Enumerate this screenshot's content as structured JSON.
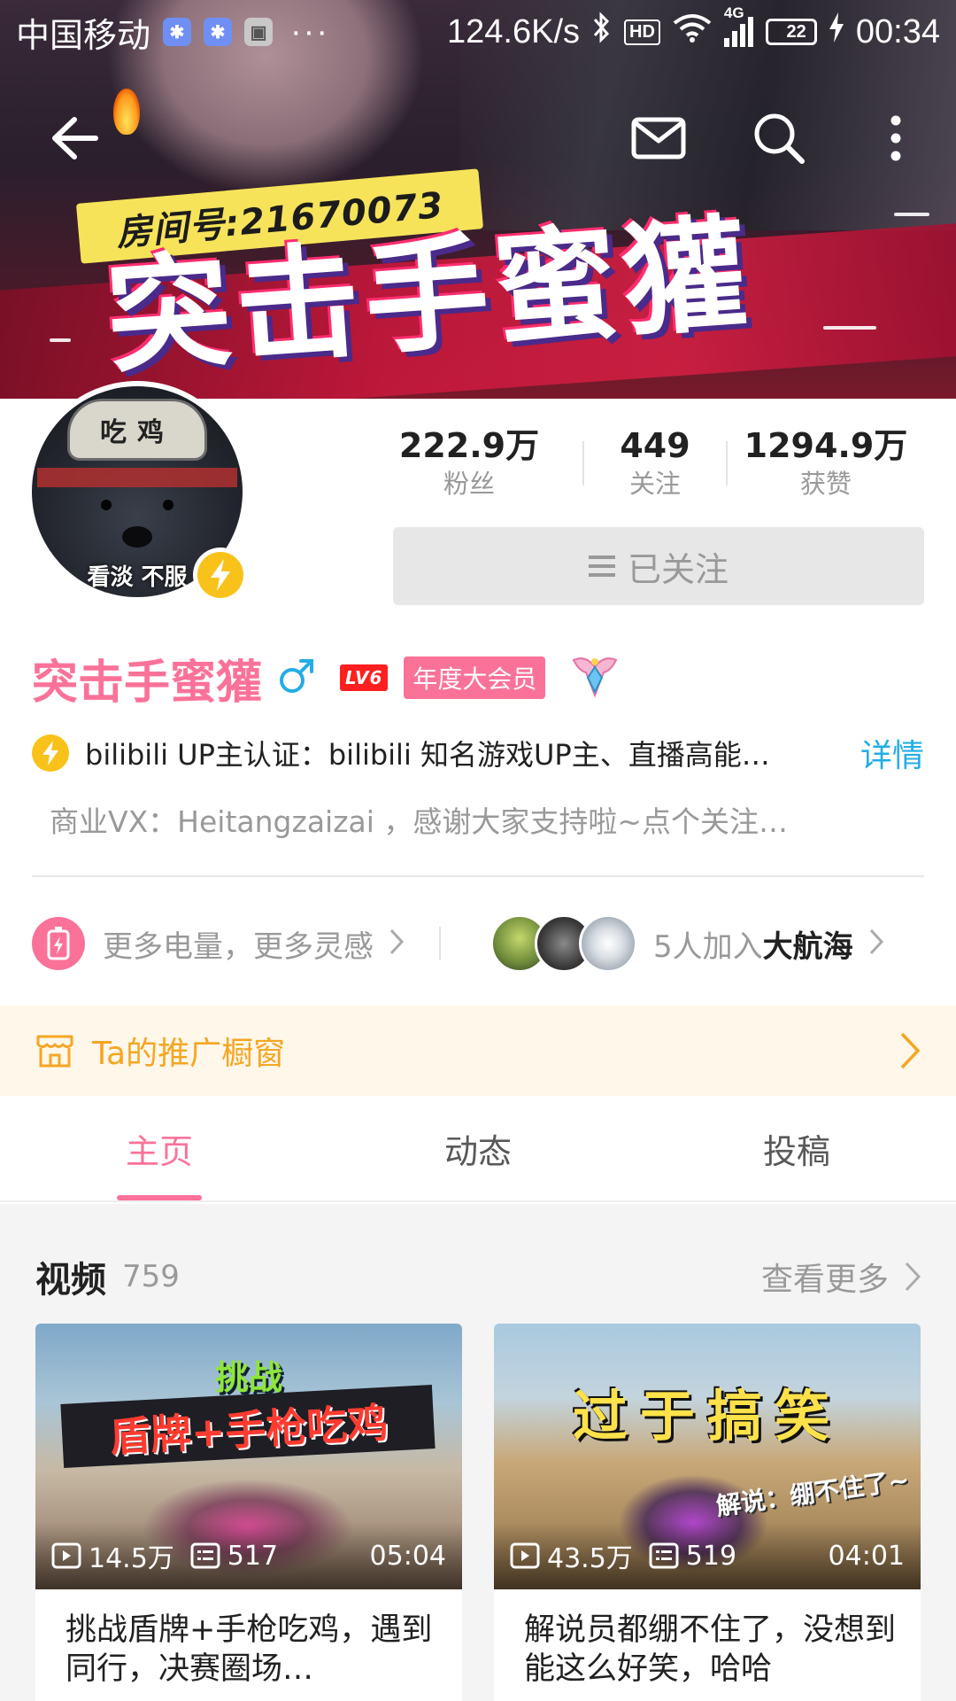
{
  "status_bar": {
    "carrier": "中国移动",
    "dots": "···",
    "speed": "124.6K/s",
    "hd": "HD",
    "network": "4G",
    "battery": "22",
    "time": "00:34"
  },
  "banner": {
    "room_tag": "房间号:21670073",
    "title": "突击手蜜獾"
  },
  "avatar": {
    "helmet_text": "吃鸡",
    "caption": "看淡 不服"
  },
  "stats": [
    {
      "value": "222.9万",
      "label": "粉丝"
    },
    {
      "value": "449",
      "label": "关注"
    },
    {
      "value": "1294.9万",
      "label": "获赞"
    }
  ],
  "follow_button": {
    "label": "已关注"
  },
  "profile": {
    "name": "突击手蜜獾",
    "level": "LV6",
    "vip": "年度大会员",
    "certification": "bilibili UP主认证：bilibili 知名游戏UP主、直播高能…",
    "detail_link": "详情",
    "signature": "商业VX：Heitangzaizai ，感谢大家支持啦~点个关注…"
  },
  "charge": {
    "text": "更多电量，更多灵感"
  },
  "guard": {
    "text_prefix": "5人加入",
    "text_bold": "大航海"
  },
  "shop": {
    "label": "Ta的推广橱窗"
  },
  "tabs": [
    {
      "label": "主页",
      "active": true
    },
    {
      "label": "动态",
      "active": false
    },
    {
      "label": "投稿",
      "active": false
    }
  ],
  "videos_section": {
    "title": "视频",
    "count": "759",
    "more": "查看更多",
    "items": [
      {
        "thumb_line1": "挑战",
        "thumb_line2": "盾牌+手枪吃鸡",
        "views": "14.5万",
        "danmaku": "517",
        "duration": "05:04",
        "title": "挑战盾牌+手枪吃鸡，遇到同行，决赛圈场…"
      },
      {
        "thumb_line1": "过于搞笑",
        "thumb_line2": "解说：绷不住了~",
        "views": "43.5万",
        "danmaku": "519",
        "duration": "04:01",
        "title": "解说员都绷不住了，没想到能这么好笑，哈哈"
      }
    ]
  },
  "colors": {
    "brand_pink": "#fb7299",
    "link_blue": "#23ade5",
    "verify_yellow": "#f9c21a",
    "shop_orange": "#f5a623"
  }
}
